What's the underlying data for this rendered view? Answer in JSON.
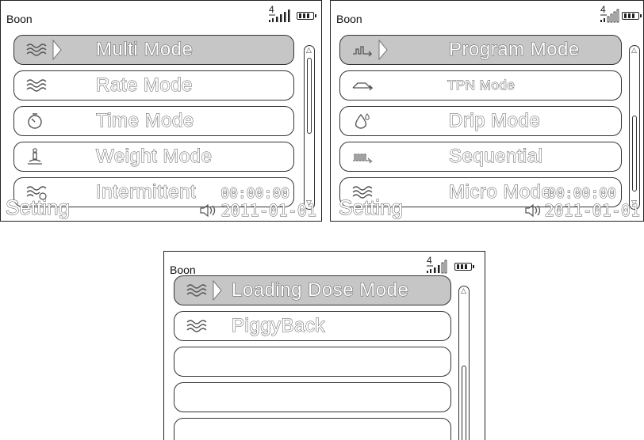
{
  "panels": [
    {
      "brand": "Boon",
      "signal_digit": "4",
      "items": [
        {
          "label": "Multi Mode",
          "icon": "waves-icon",
          "selected": true
        },
        {
          "label": "Rate Mode",
          "icon": "waves-icon",
          "selected": false
        },
        {
          "label": "Time   Mode",
          "icon": "stopwatch-icon",
          "selected": false
        },
        {
          "label": "Weight Mode",
          "icon": "weight-icon",
          "selected": false
        },
        {
          "label": "Intermittent",
          "icon": "waves-cycle-icon",
          "selected": false
        }
      ],
      "footer": {
        "setting": "Setting",
        "time": "00:00:00",
        "date": "2011-01-01"
      }
    },
    {
      "brand": "Boon",
      "signal_digit": "4",
      "items": [
        {
          "label": "Program Mode",
          "icon": "program-steps-icon",
          "selected": true
        },
        {
          "label": "TPN Mode",
          "icon": "tpn-curve-icon",
          "selected": false
        },
        {
          "label": "Drip Mode",
          "icon": "drop-icon",
          "selected": false
        },
        {
          "label": "Sequential",
          "icon": "sequential-icon",
          "selected": false
        },
        {
          "label": "Micro Mode",
          "icon": "waves-icon",
          "selected": false
        }
      ],
      "footer": {
        "setting": "Setting",
        "time": "00:00:00",
        "date": "2011-01-01"
      }
    },
    {
      "brand": "Boon",
      "signal_digit": "4",
      "items": [
        {
          "label": "Loading Dose Mode",
          "icon": "waves-icon",
          "selected": true
        },
        {
          "label": "PiggyBack",
          "icon": "waves-icon",
          "selected": false
        },
        {
          "label": "",
          "icon": "",
          "selected": false
        },
        {
          "label": "",
          "icon": "",
          "selected": false
        },
        {
          "label": "",
          "icon": "",
          "selected": false
        }
      ]
    }
  ]
}
